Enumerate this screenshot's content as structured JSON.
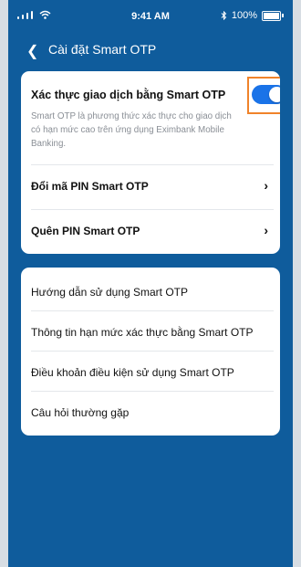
{
  "status": {
    "time": "9:41 AM",
    "battery": "100%"
  },
  "nav": {
    "title": "Cài đặt Smart OTP"
  },
  "settings": {
    "toggle_title": "Xác thực giao dịch bằng Smart OTP",
    "toggle_description": "Smart OTP là phương thức xác thực cho giao dịch có hạn mức cao trên ứng dụng Eximbank Mobile Banking.",
    "toggle_on": true,
    "change_pin": "Đổi mã PIN Smart OTP",
    "forgot_pin": "Quên PIN Smart OTP"
  },
  "info_links": [
    "Hướng dẫn sử dụng Smart OTP",
    "Thông tin hạn mức xác thực bằng Smart OTP",
    "Điều khoản điều kiện sử dụng Smart OTP",
    "Câu hỏi thường gặp"
  ],
  "colors": {
    "brand_blue": "#0f5c9c",
    "toggle_blue": "#1a73e8",
    "highlight_orange": "#f0832a"
  }
}
